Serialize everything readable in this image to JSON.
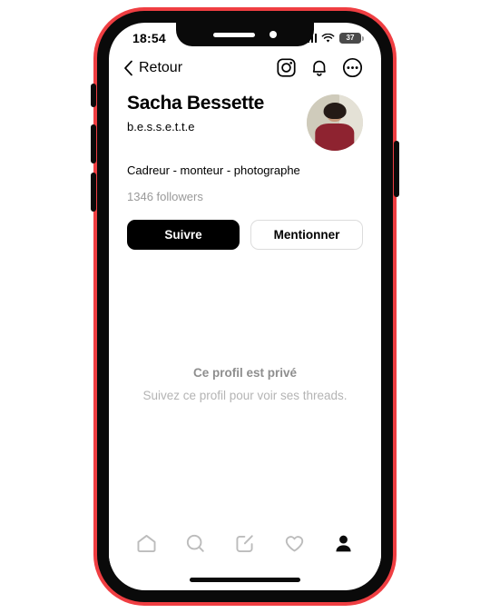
{
  "status_bar": {
    "time": "18:54",
    "signal_icon": "cellular-signal-icon",
    "wifi_icon": "wifi-icon",
    "battery_level": "37"
  },
  "header": {
    "back_label": "Retour",
    "back_icon": "chevron-left-icon",
    "actions": [
      {
        "name": "instagram-icon",
        "label": "Instagram"
      },
      {
        "name": "bell-icon",
        "label": "Notifications"
      },
      {
        "name": "more-options-icon",
        "label": "Plus"
      }
    ]
  },
  "profile": {
    "display_name": "Sacha Bessette",
    "handle": "b.e.s.s.e.t.t.e",
    "bio": "Cadreur - monteur - photographe",
    "followers": "1346 followers",
    "avatar_alt": "Photo de profil"
  },
  "actions": {
    "follow_label": "Suivre",
    "mention_label": "Mentionner"
  },
  "empty_state": {
    "title": "Ce profil est privé",
    "subtitle": "Suivez ce profil pour voir ses threads."
  },
  "tabbar": {
    "items": [
      {
        "name": "home-icon",
        "label": "Accueil",
        "active": false
      },
      {
        "name": "search-icon",
        "label": "Recherche",
        "active": false
      },
      {
        "name": "compose-icon",
        "label": "Créer",
        "active": false
      },
      {
        "name": "heart-icon",
        "label": "Activité",
        "active": false
      },
      {
        "name": "profile-icon",
        "label": "Profil",
        "active": true
      }
    ]
  },
  "colors": {
    "frame": "#ef3e42",
    "bezel": "#0a0a0a",
    "primary_button": "#000000",
    "muted_text": "#9a9a9a"
  }
}
